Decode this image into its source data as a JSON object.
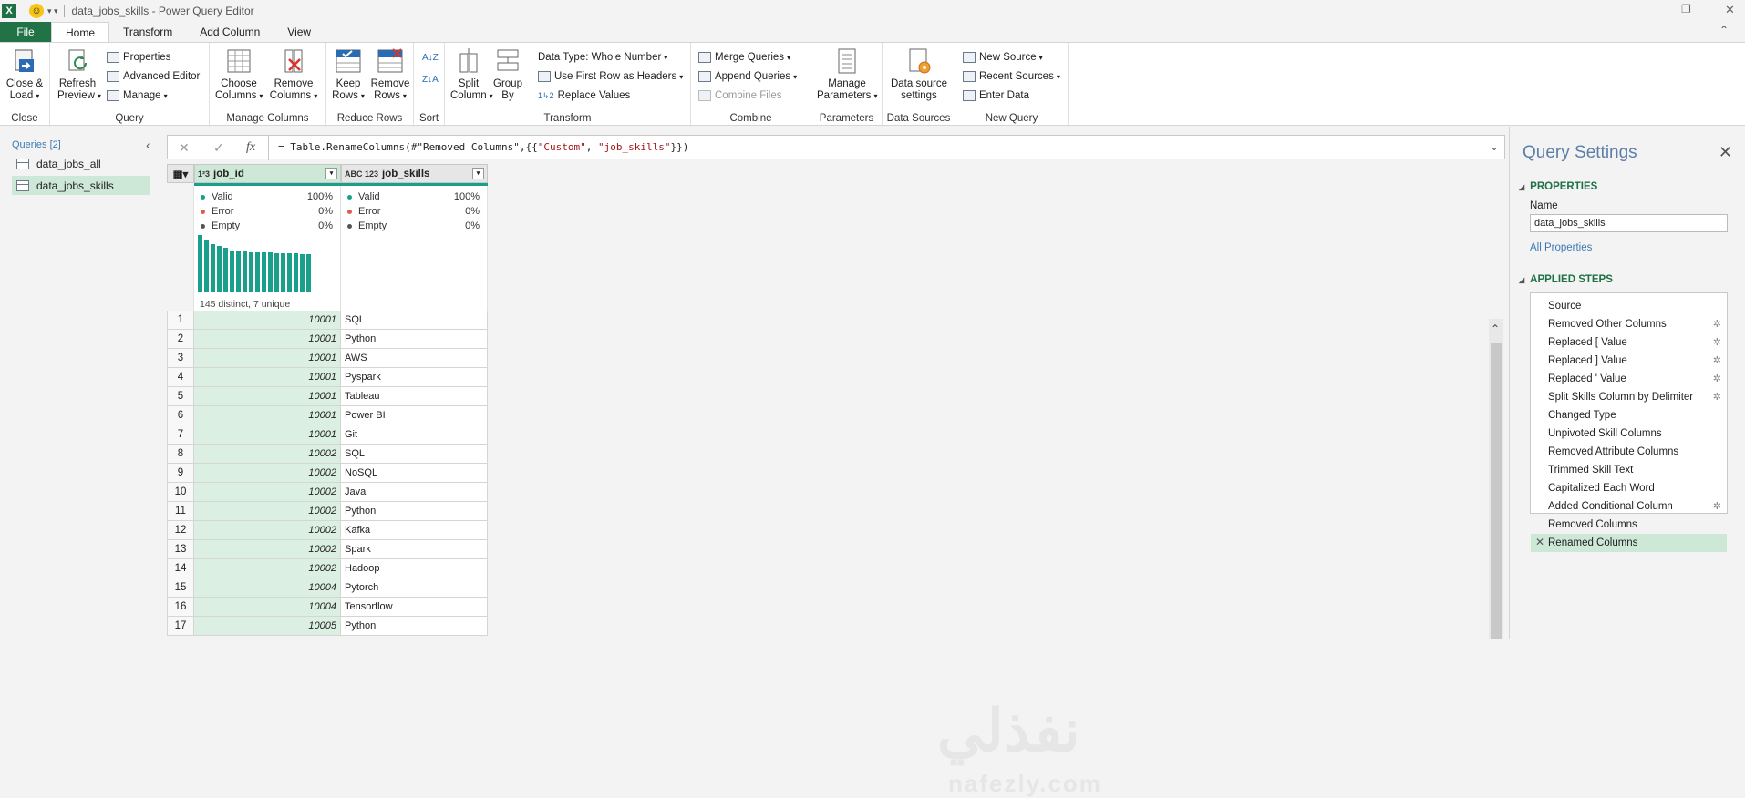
{
  "window": {
    "title": "data_jobs_skills - Power Query Editor",
    "app_icon": "X"
  },
  "tabs": [
    {
      "label": "File"
    },
    {
      "label": "Home"
    },
    {
      "label": "Transform"
    },
    {
      "label": "Add Column"
    },
    {
      "label": "View"
    }
  ],
  "ribbon": {
    "close": {
      "btn": "Close & Load",
      "group": "Close"
    },
    "query": {
      "refresh": "Refresh Preview",
      "properties": "Properties",
      "advanced_editor": "Advanced Editor",
      "manage": "Manage",
      "group": "Query"
    },
    "manage_columns": {
      "choose": "Choose Columns",
      "remove": "Remove Columns",
      "group": "Manage Columns"
    },
    "reduce_rows": {
      "keep": "Keep Rows",
      "remove": "Remove Rows",
      "group": "Reduce Rows"
    },
    "sort": {
      "group": "Sort"
    },
    "transform": {
      "split": "Split Column",
      "group_by": "Group By",
      "data_type": "Data Type: Whole Number",
      "first_row": "Use First Row as Headers",
      "replace": "Replace Values",
      "group": "Transform"
    },
    "combine": {
      "merge": "Merge Queries",
      "append": "Append Queries",
      "combine_files": "Combine Files",
      "group": "Combine"
    },
    "parameters": {
      "manage": "Manage Parameters",
      "group": "Parameters"
    },
    "data_sources": {
      "settings": "Data source settings",
      "group": "Data Sources"
    },
    "new_query": {
      "new_source": "New Source",
      "recent": "Recent Sources",
      "enter_data": "Enter Data",
      "group": "New Query"
    }
  },
  "queries": {
    "header": "Queries [2]",
    "items": [
      {
        "name": "data_jobs_all"
      },
      {
        "name": "data_jobs_skills"
      }
    ]
  },
  "formula_bar": {
    "prefix": "= Table.RenameColumns(#\"Removed Columns\",{{",
    "str1": "\"Custom\"",
    "mid": ", ",
    "str2": "\"job_skills\"",
    "suffix": "}})",
    "fx": "fx"
  },
  "columns": [
    {
      "type": "1²3",
      "name": "job_id",
      "valid": "100%",
      "error": "0%",
      "empty": "0%",
      "distinct": "145 distinct, 7 unique"
    },
    {
      "type": "ABC 123",
      "name": "job_skills",
      "valid": "100%",
      "error": "0%",
      "empty": "0%"
    }
  ],
  "profile_labels": {
    "valid": "Valid",
    "error": "Error",
    "empty": "Empty"
  },
  "histogram": [
    60,
    54,
    50,
    48,
    46,
    44,
    43,
    43,
    42,
    42,
    42,
    42,
    41,
    41,
    41,
    41,
    40,
    40
  ],
  "rows": [
    {
      "n": "1",
      "job_id": "10001",
      "skill": "SQL"
    },
    {
      "n": "2",
      "job_id": "10001",
      "skill": "Python"
    },
    {
      "n": "3",
      "job_id": "10001",
      "skill": "AWS"
    },
    {
      "n": "4",
      "job_id": "10001",
      "skill": "Pyspark"
    },
    {
      "n": "5",
      "job_id": "10001",
      "skill": "Tableau"
    },
    {
      "n": "6",
      "job_id": "10001",
      "skill": "Power BI"
    },
    {
      "n": "7",
      "job_id": "10001",
      "skill": "Git"
    },
    {
      "n": "8",
      "job_id": "10002",
      "skill": "SQL"
    },
    {
      "n": "9",
      "job_id": "10002",
      "skill": "NoSQL"
    },
    {
      "n": "10",
      "job_id": "10002",
      "skill": "Java"
    },
    {
      "n": "11",
      "job_id": "10002",
      "skill": "Python"
    },
    {
      "n": "12",
      "job_id": "10002",
      "skill": "Kafka"
    },
    {
      "n": "13",
      "job_id": "10002",
      "skill": "Spark"
    },
    {
      "n": "14",
      "job_id": "10002",
      "skill": "Hadoop"
    },
    {
      "n": "15",
      "job_id": "10004",
      "skill": "Pytorch"
    },
    {
      "n": "16",
      "job_id": "10004",
      "skill": "Tensorflow"
    },
    {
      "n": "17",
      "job_id": "10005",
      "skill": "Python"
    }
  ],
  "watermark": {
    "ar": "نفذلي",
    "en": "nafezly.com"
  },
  "settings": {
    "title": "Query Settings",
    "properties": "PROPERTIES",
    "name_label": "Name",
    "name_value": "data_jobs_skills",
    "all_properties": "All Properties",
    "applied_steps": "APPLIED STEPS",
    "steps": [
      {
        "name": "Source",
        "gear": false
      },
      {
        "name": "Removed Other Columns",
        "gear": true
      },
      {
        "name": "Replaced [ Value",
        "gear": true
      },
      {
        "name": "Replaced ] Value",
        "gear": true
      },
      {
        "name": "Replaced ' Value",
        "gear": true
      },
      {
        "name": "Split Skills Column by Delimiter",
        "gear": true
      },
      {
        "name": "Changed Type",
        "gear": false
      },
      {
        "name": "Unpivoted Skill Columns",
        "gear": false
      },
      {
        "name": "Removed Attribute Columns",
        "gear": false
      },
      {
        "name": "Trimmed Skill Text",
        "gear": false
      },
      {
        "name": "Capitalized Each Word",
        "gear": false
      },
      {
        "name": "Added Conditional Column",
        "gear": true
      },
      {
        "name": "Removed Columns",
        "gear": false
      },
      {
        "name": "Renamed Columns",
        "gear": false,
        "selected": true
      }
    ]
  }
}
